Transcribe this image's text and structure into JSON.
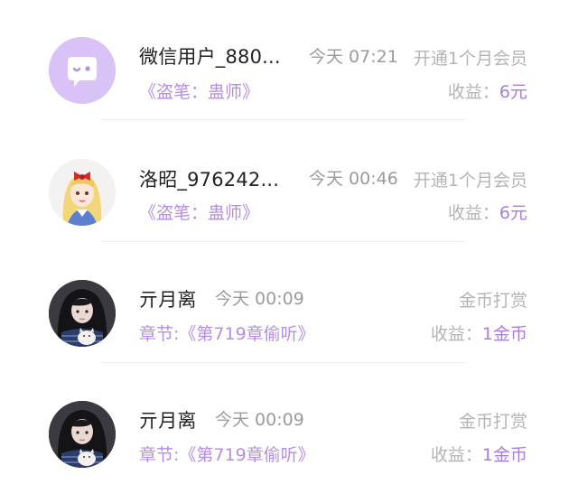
{
  "records": [
    {
      "avatar": "wechat-chat-bubble-avatar",
      "name": "微信用户_880...",
      "time": "今天 07:21",
      "type": "开通1个月会员",
      "work": "《盗笔：蛊师》",
      "earn_label": "收益：",
      "earn_value": "6元"
    },
    {
      "avatar": "anime-girl-red-bow-avatar",
      "name": "洛昭_976242...",
      "time": "今天 00:46",
      "type": "开通1个月会员",
      "work": "《盗笔：蛊师》",
      "earn_label": "收益：",
      "earn_value": "6元"
    },
    {
      "avatar": "girl-with-cat-avatar",
      "name": "亓月离",
      "time": "今天 00:09",
      "type": "金币打赏",
      "work": "章节:《第719章偷听》",
      "earn_label": "收益：",
      "earn_value": "1金币"
    },
    {
      "avatar": "girl-with-cat-avatar",
      "name": "亓月离",
      "time": "今天 00:09",
      "type": "金币打赏",
      "work": "章节:《第719章偷听》",
      "earn_label": "收益：",
      "earn_value": "1金币"
    }
  ],
  "colors": {
    "accent": "#a67fdc",
    "work_link": "#b48ee2",
    "muted": "#b4b4b4",
    "avatar_bg": "#d9c2f6"
  }
}
